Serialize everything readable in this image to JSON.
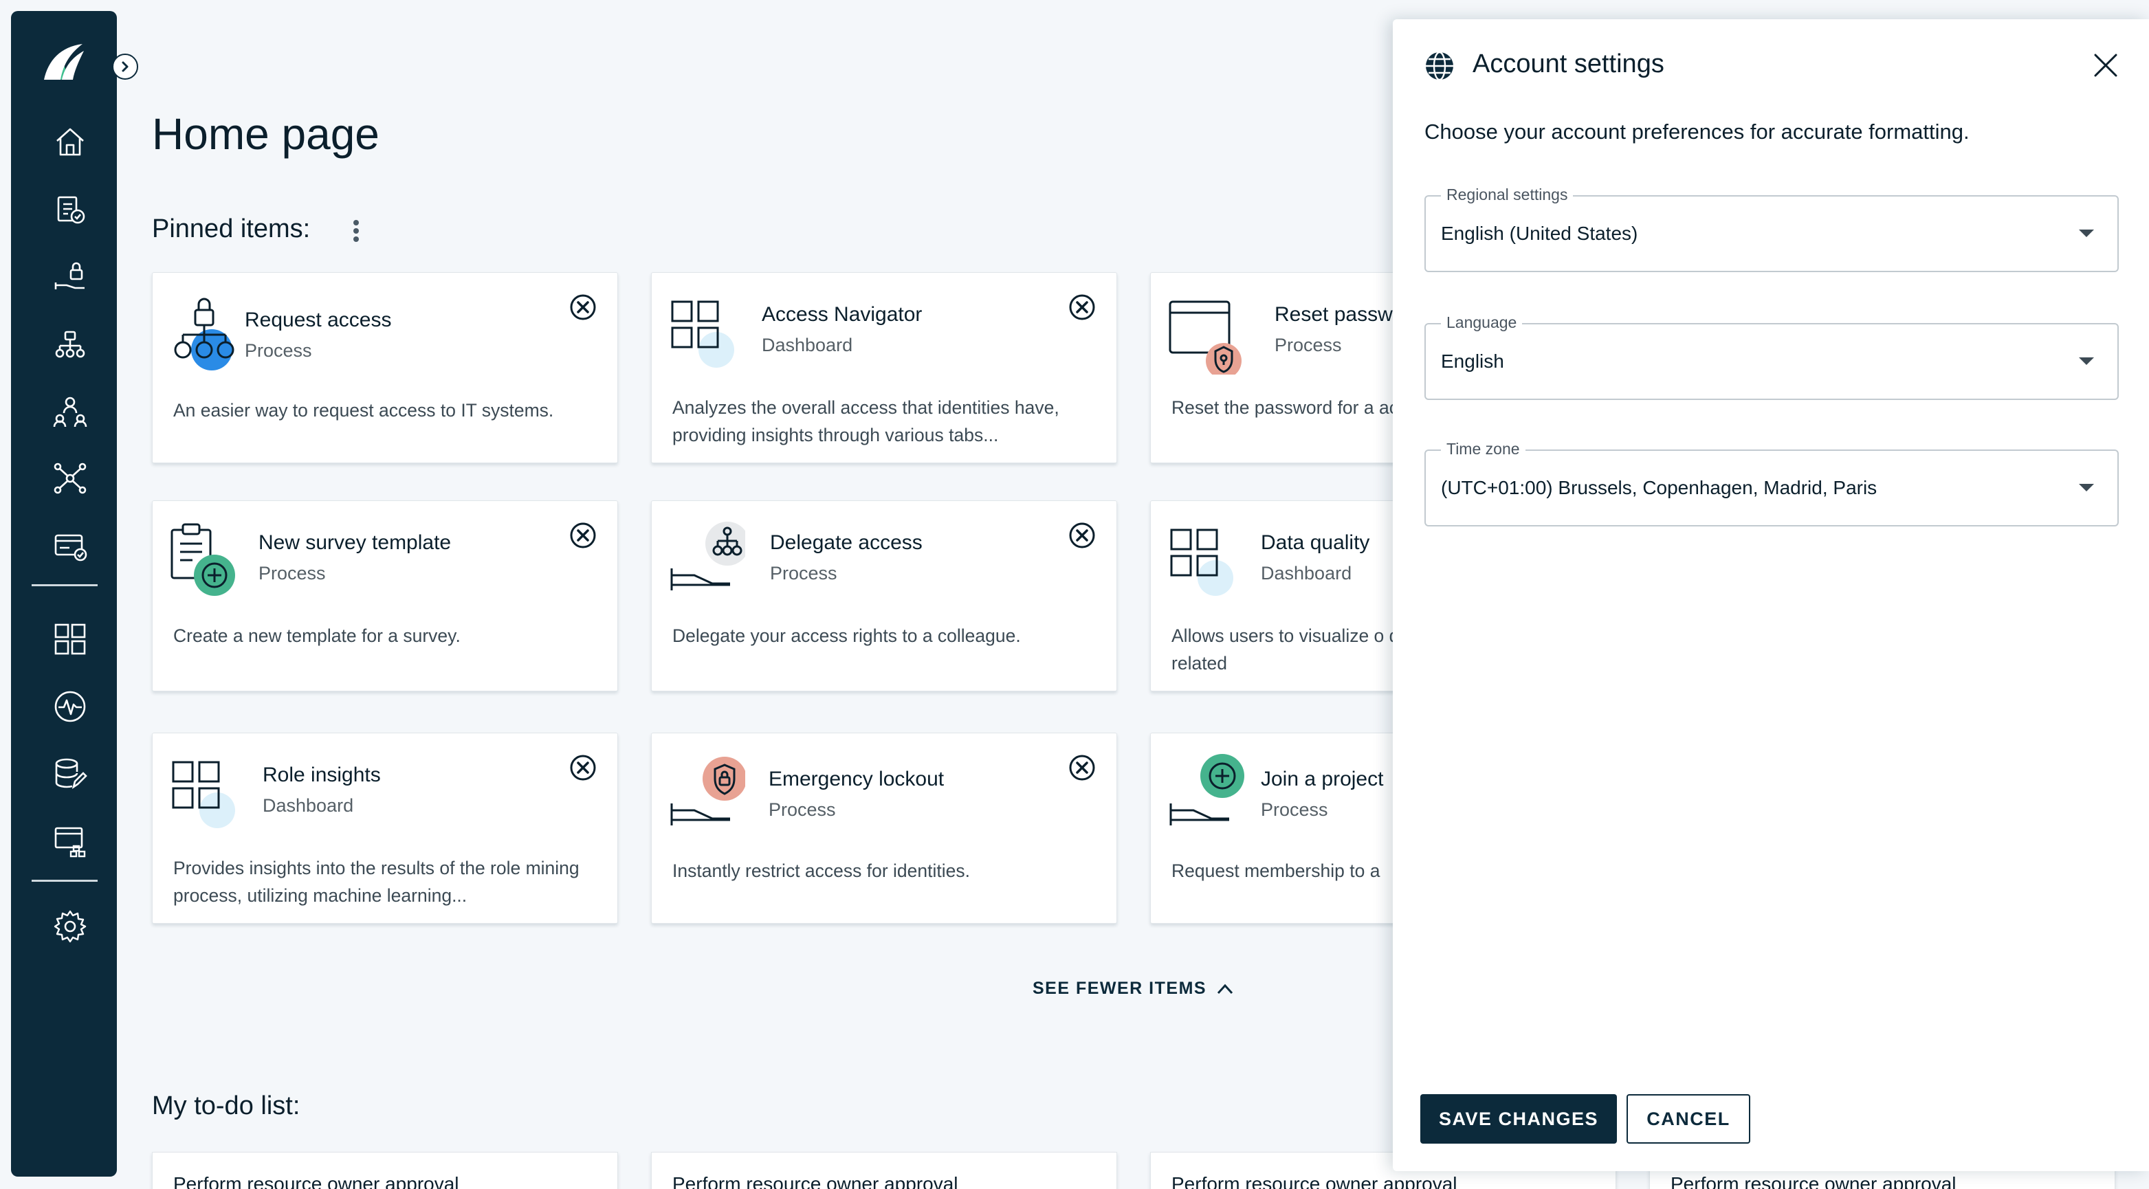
{
  "sidebar": {
    "logo": "brand-logo",
    "toggle_icon": "chevron-right-icon",
    "items": [
      {
        "icon": "home-icon"
      },
      {
        "icon": "clipboard-check-icon"
      },
      {
        "icon": "hand-lock-icon"
      },
      {
        "icon": "org-lock-icon"
      },
      {
        "icon": "people-network-icon"
      },
      {
        "icon": "network-nodes-icon"
      },
      {
        "icon": "card-check-icon"
      },
      {
        "icon": "dashboard-grid-icon"
      },
      {
        "icon": "activity-icon"
      },
      {
        "icon": "database-edit-icon"
      },
      {
        "icon": "window-tree-icon"
      },
      {
        "icon": "gear-icon"
      }
    ]
  },
  "main": {
    "title": "Home page",
    "pinned_title": "Pinned items:",
    "cards": [
      {
        "title": "Request access",
        "subtitle": "Process",
        "description": "An easier way to request access to IT systems."
      },
      {
        "title": "Access Navigator",
        "subtitle": "Dashboard",
        "description": " Analyzes the overall access that identities have, providing insights through various tabs..."
      },
      {
        "title": "Reset passw",
        "subtitle": "Process",
        "description": "Reset the password for a account."
      },
      {
        "title": "New survey template",
        "subtitle": "Process",
        "description": "Create a new template for a survey."
      },
      {
        "title": "Delegate access",
        "subtitle": "Process",
        "description": "Delegate your access rights to a colleague."
      },
      {
        "title": "Data quality",
        "subtitle": "Dashboard",
        "description": "Allows users to visualize o data quality issues related"
      },
      {
        "title": "Role insights",
        "subtitle": "Dashboard",
        "description": "Provides insights into the results of the role mining process, utilizing machine learning..."
      },
      {
        "title": "Emergency lockout",
        "subtitle": "Process",
        "description": "Instantly restrict access for identities."
      },
      {
        "title": "Join a project",
        "subtitle": "Process",
        "description": "Request membership to a"
      }
    ],
    "see_fewer": "SEE FEWER ITEMS",
    "todo_title": "My to-do list:",
    "todo_items": [
      "Perform resource owner approval",
      "Perform resource owner approval",
      "Perform resource owner approval",
      "Perform resource owner approval"
    ]
  },
  "panel": {
    "title": "Account settings",
    "description": "Choose your account preferences for accurate formatting.",
    "fields": [
      {
        "label": "Regional settings",
        "value": "English (United States)"
      },
      {
        "label": "Language",
        "value": "English"
      },
      {
        "label": "Time zone",
        "value": "(UTC+01:00) Brussels, Copenhagen, Madrid, Paris"
      }
    ],
    "save_label": "SAVE CHANGES",
    "cancel_label": "CANCEL"
  },
  "colors": {
    "sidebar_bg": "#0c2a3b",
    "accent_blue": "#2a8be6",
    "accent_green": "#45b38d",
    "accent_red": "#e8a293",
    "accent_light_blue": "#dcf0fa"
  }
}
